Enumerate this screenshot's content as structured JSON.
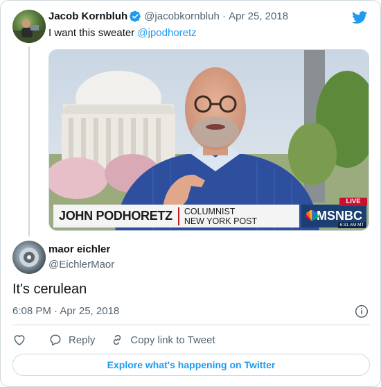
{
  "parent_tweet": {
    "author_name": "Jacob Kornbluh",
    "author_handle": "@jacobkornbluh",
    "date": "Apr 25, 2018",
    "text": "I want this sweater ",
    "mention": "@jpodhoretz",
    "media": {
      "lower_third_name": "JOHN PODHORETZ",
      "lower_third_role_line1": "COLUMNIST",
      "lower_third_role_line2": "NEW YORK POST",
      "network": "MSNBC",
      "live_label": "LIVE",
      "clock": "6:31 AM MT"
    }
  },
  "reply_tweet": {
    "author_name": "maor eichler",
    "author_handle": "@EichlerMaor",
    "text": "It's cerulean",
    "timestamp": "6:08 PM · Apr 25, 2018"
  },
  "actions": {
    "like_icon": "heart-icon",
    "reply_label": "Reply",
    "copy_link_label": "Copy link to Tweet"
  },
  "explore_label": "Explore what's happening on Twitter",
  "colors": {
    "accent": "#1d9bf0",
    "text_primary": "#0f1419",
    "text_muted": "#536471",
    "border": "#cfd9de",
    "sweater": "#2d4f9e"
  }
}
